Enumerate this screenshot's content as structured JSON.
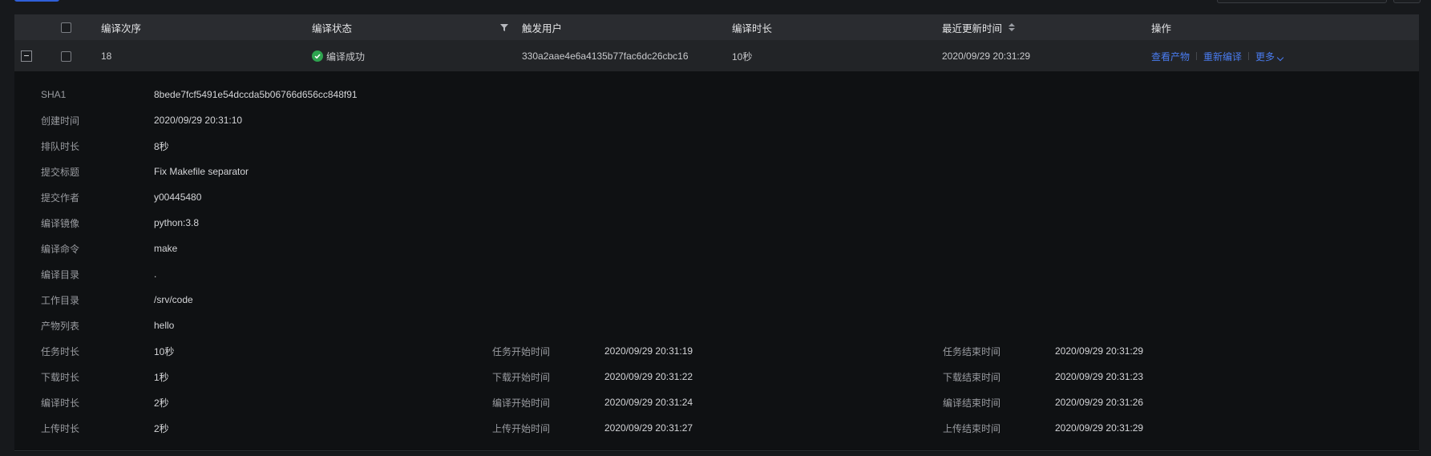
{
  "table": {
    "columns": {
      "order": "编译次序",
      "status": "编译状态",
      "trigger_user": "触发用户",
      "duration": "编译时长",
      "updated": "最近更新时间",
      "actions": "操作"
    },
    "row": {
      "order": "18",
      "status": "编译成功",
      "trigger_user": "330a2aae4e6a4135b77fac6dc26cbc16",
      "duration": "10秒",
      "updated": "2020/09/29 20:31:29",
      "actions": {
        "view_artifacts": "查看产物",
        "rebuild": "重新编译",
        "more": "更多"
      }
    }
  },
  "detail": {
    "sha1": {
      "label": "SHA1",
      "value": "8bede7fcf5491e54dccda5b06766d656cc848f91"
    },
    "created": {
      "label": "创建时间",
      "value": "2020/09/29 20:31:10"
    },
    "queue": {
      "label": "排队时长",
      "value": "8秒"
    },
    "commit_title": {
      "label": "提交标题",
      "value": "Fix Makefile separator"
    },
    "commit_author": {
      "label": "提交作者",
      "value": "y00445480"
    },
    "image": {
      "label": "编译镜像",
      "value": "python:3.8"
    },
    "command": {
      "label": "编译命令",
      "value": "make"
    },
    "build_dir": {
      "label": "编译目录",
      "value": "."
    },
    "work_dir": {
      "label": "工作目录",
      "value": "/srv/code"
    },
    "artifacts": {
      "label": "产物列表",
      "value": "hello"
    },
    "task": {
      "duration_label": "任务时长",
      "duration": "10秒",
      "start_label": "任务开始时间",
      "start": "2020/09/29 20:31:19",
      "end_label": "任务结束时间",
      "end": "2020/09/29 20:31:29"
    },
    "download": {
      "duration_label": "下载时长",
      "duration": "1秒",
      "start_label": "下载开始时间",
      "start": "2020/09/29 20:31:22",
      "end_label": "下载结束时间",
      "end": "2020/09/29 20:31:23"
    },
    "compile": {
      "duration_label": "编译时长",
      "duration": "2秒",
      "start_label": "编译开始时间",
      "start": "2020/09/29 20:31:24",
      "end_label": "编译结束时间",
      "end": "2020/09/29 20:31:26"
    },
    "upload": {
      "duration_label": "上传时长",
      "duration": "2秒",
      "start_label": "上传开始时间",
      "start": "2020/09/29 20:31:27",
      "end_label": "上传结束时间",
      "end": "2020/09/29 20:31:29"
    }
  },
  "colors": {
    "accent": "#4a7cf0",
    "success": "#2ea44f",
    "background": "#17191c",
    "detail_background": "#0f1113"
  }
}
